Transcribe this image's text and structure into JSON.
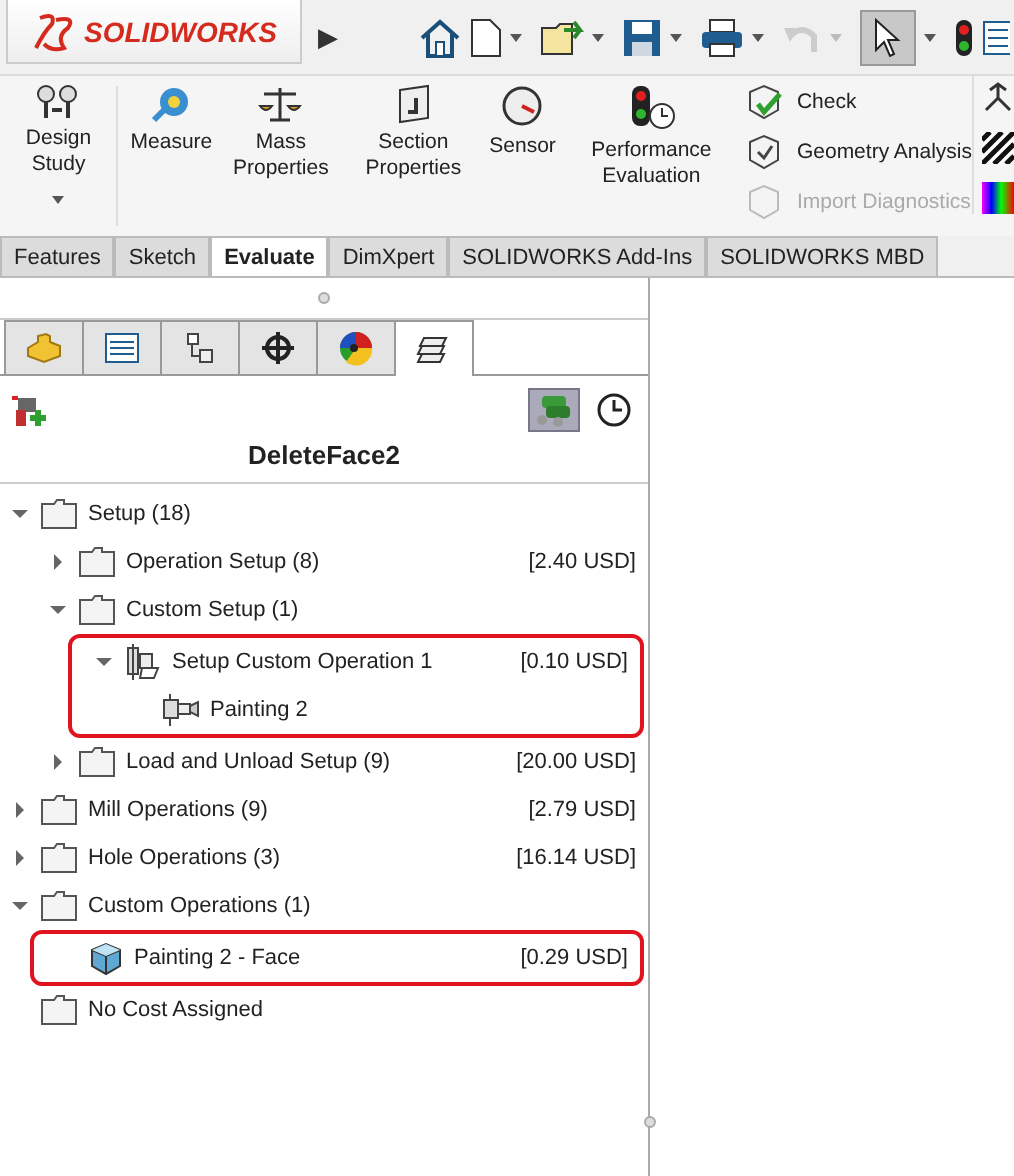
{
  "toolbar": {
    "logo": "SOLIDWORKS",
    "expand_arrow": "▶",
    "select_pressed": true,
    "undo_disabled": true
  },
  "ribbon": {
    "tools": [
      {
        "kind": "large",
        "label": "Design Study",
        "dropdown": true,
        "separator_after": true
      },
      {
        "kind": "large",
        "label": "Measure"
      },
      {
        "kind": "large",
        "label": "Mass Properties"
      },
      {
        "kind": "large",
        "label": "Section Properties"
      },
      {
        "kind": "large",
        "label": "Sensor"
      },
      {
        "kind": "large",
        "label": "Performance Evaluation"
      }
    ],
    "small_tools": [
      {
        "label": "Check",
        "disabled": false
      },
      {
        "label": "Geometry Analysis",
        "disabled": false
      },
      {
        "label": "Import Diagnostics",
        "disabled": true
      }
    ]
  },
  "tabs": [
    {
      "label": "Features",
      "selected": false
    },
    {
      "label": "Sketch",
      "selected": false
    },
    {
      "label": "Evaluate",
      "selected": true
    },
    {
      "label": "DimXpert",
      "selected": false
    },
    {
      "label": "SOLIDWORKS Add-Ins",
      "selected": false
    },
    {
      "label": "SOLIDWORKS MBD",
      "selected": false
    }
  ],
  "panel": {
    "tabs": [
      {
        "selected": false
      },
      {
        "selected": false
      },
      {
        "selected": false
      },
      {
        "selected": false
      },
      {
        "selected": false
      },
      {
        "selected": true
      }
    ],
    "view_pressed": true,
    "title": "DeleteFace2"
  },
  "tree": {
    "items": [
      {
        "kind": "folder",
        "label": "Setup (18)",
        "expanded": true,
        "children": [
          {
            "kind": "folder",
            "label": "Operation Setup (8)",
            "cost": "[2.40 USD]",
            "expanded": false
          },
          {
            "kind": "folder",
            "label": "Custom Setup (1)",
            "expanded": true,
            "children": [
              {
                "kind": "operation",
                "label": "Setup Custom Operation 1",
                "cost": "[0.10 USD]",
                "expanded": true,
                "highlighted": true,
                "children": [
                  {
                    "kind": "tool",
                    "label": "Painting 2"
                  }
                ]
              }
            ]
          },
          {
            "kind": "folder",
            "label": "Load and Unload Setup (9)",
            "cost": "[20.00 USD]",
            "expanded": false
          }
        ]
      },
      {
        "kind": "folder",
        "label": "Mill Operations (9)",
        "cost": "[2.79 USD]",
        "expanded": false
      },
      {
        "kind": "folder",
        "label": "Hole Operations (3)",
        "cost": "[16.14 USD]",
        "expanded": false
      },
      {
        "kind": "folder",
        "label": "Custom Operations (1)",
        "expanded": true,
        "children": [
          {
            "kind": "face",
            "label": "Painting 2 - Face",
            "cost": "[0.29 USD]",
            "highlighted": true
          }
        ]
      },
      {
        "kind": "folder",
        "label": "No Cost Assigned"
      }
    ]
  }
}
